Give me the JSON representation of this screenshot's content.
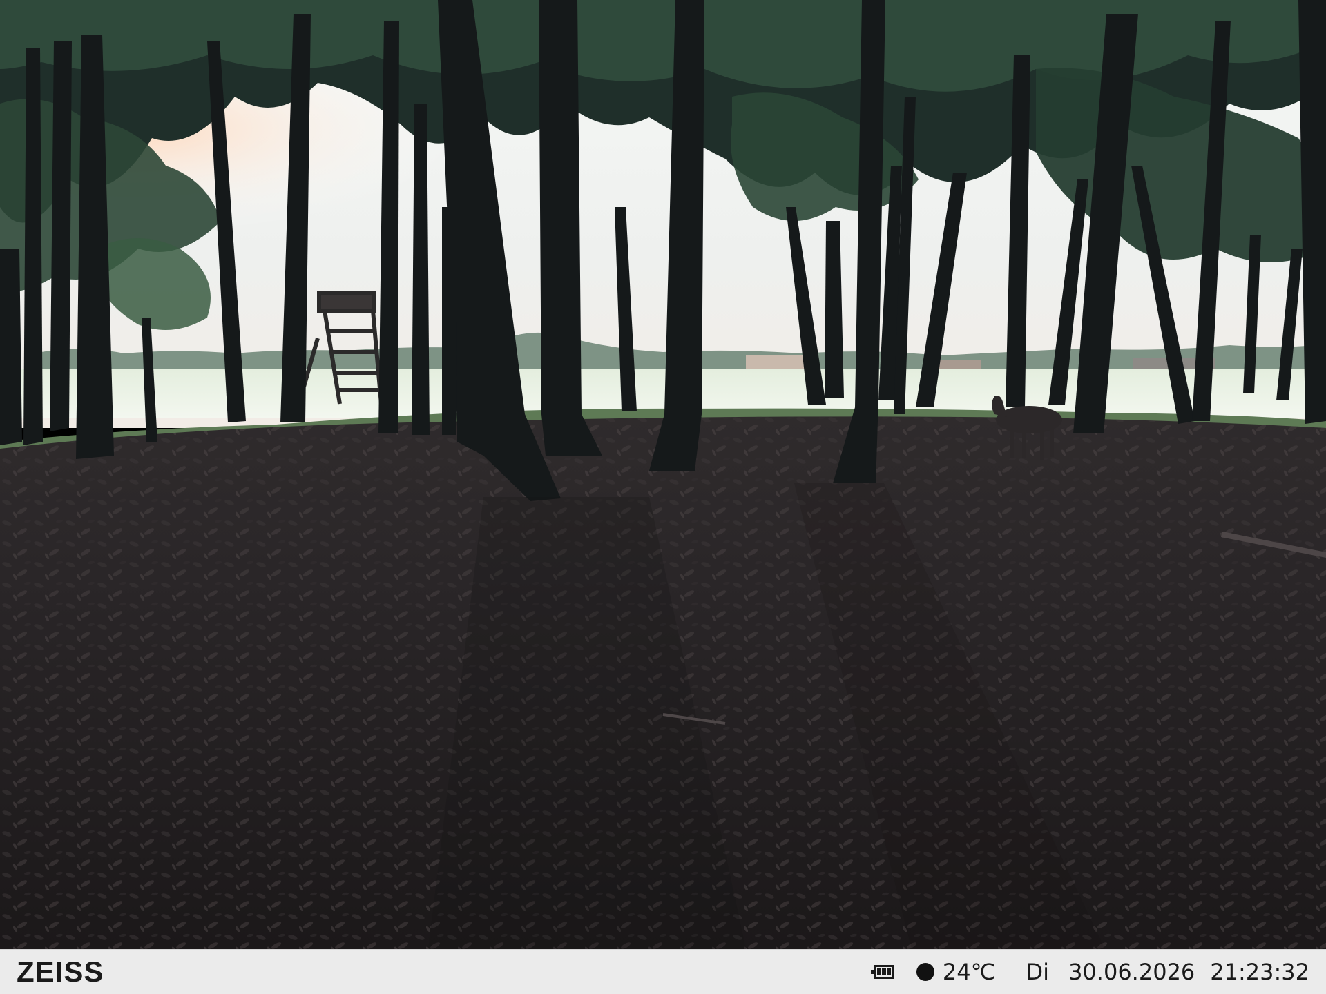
{
  "camera": {
    "brand": "ZEISS",
    "battery_icon": "battery-icon",
    "battery_level": 1.0,
    "recording_icon": "record-dot-icon",
    "temperature": "24℃",
    "weekday": "Di",
    "date": "30.06.2026",
    "time": "21:23:32"
  },
  "colors": {
    "infobar_background": "#ebebeb",
    "infobar_text": "#1a1a1a"
  }
}
